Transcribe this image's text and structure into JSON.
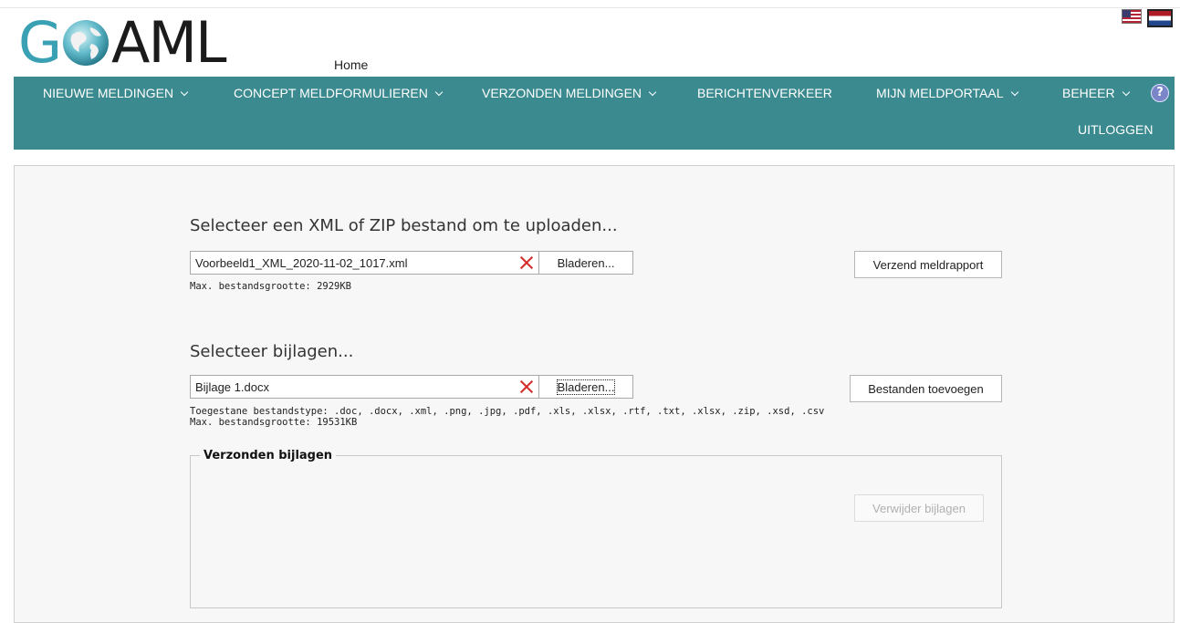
{
  "header": {
    "logo_text": "GOAML",
    "home_label": "Home",
    "flags": [
      "us-flag-icon",
      "nl-flag-icon"
    ]
  },
  "nav": {
    "items": [
      {
        "label": "NIEUWE MELDINGEN",
        "dropdown": true
      },
      {
        "label": "CONCEPT MELDFORMULIEREN",
        "dropdown": true
      },
      {
        "label": "VERZONDEN MELDINGEN",
        "dropdown": true
      },
      {
        "label": "BERICHTENVERKEER",
        "dropdown": false
      },
      {
        "label": "MIJN MELDPORTAAL",
        "dropdown": true
      },
      {
        "label": "BEHEER",
        "dropdown": true
      }
    ],
    "logout_label": "UITLOGGEN",
    "help_icon": "?",
    "background": "#3b8a8f"
  },
  "xml_upload": {
    "heading": "Selecteer een XML of ZIP bestand om te uploaden...",
    "file_value": "Voorbeeld1_XML_2020-11-02_1017.xml",
    "browse_label": "Bladeren...",
    "max_size_text": "Max. bestandsgrootte: 2929KB",
    "submit_label": "Verzend meldrapport"
  },
  "attachments": {
    "heading": "Selecteer bijlagen...",
    "file_value": "Bijlage 1.docx",
    "browse_label": "Bladeren...",
    "allowed_types_text": "Toegestane bestandstype: .doc, .docx, .xml, .png, .jpg, .pdf, .xls, .xlsx, .rtf, .txt, .xlsx, .zip, .xsd, .csv",
    "max_size_text": "Max. bestandsgrootte: 19531KB",
    "add_label": "Bestanden toevoegen"
  },
  "sent_attachments": {
    "legend": "Verzonden bijlagen",
    "delete_label": "Verwijder bijlagen"
  }
}
